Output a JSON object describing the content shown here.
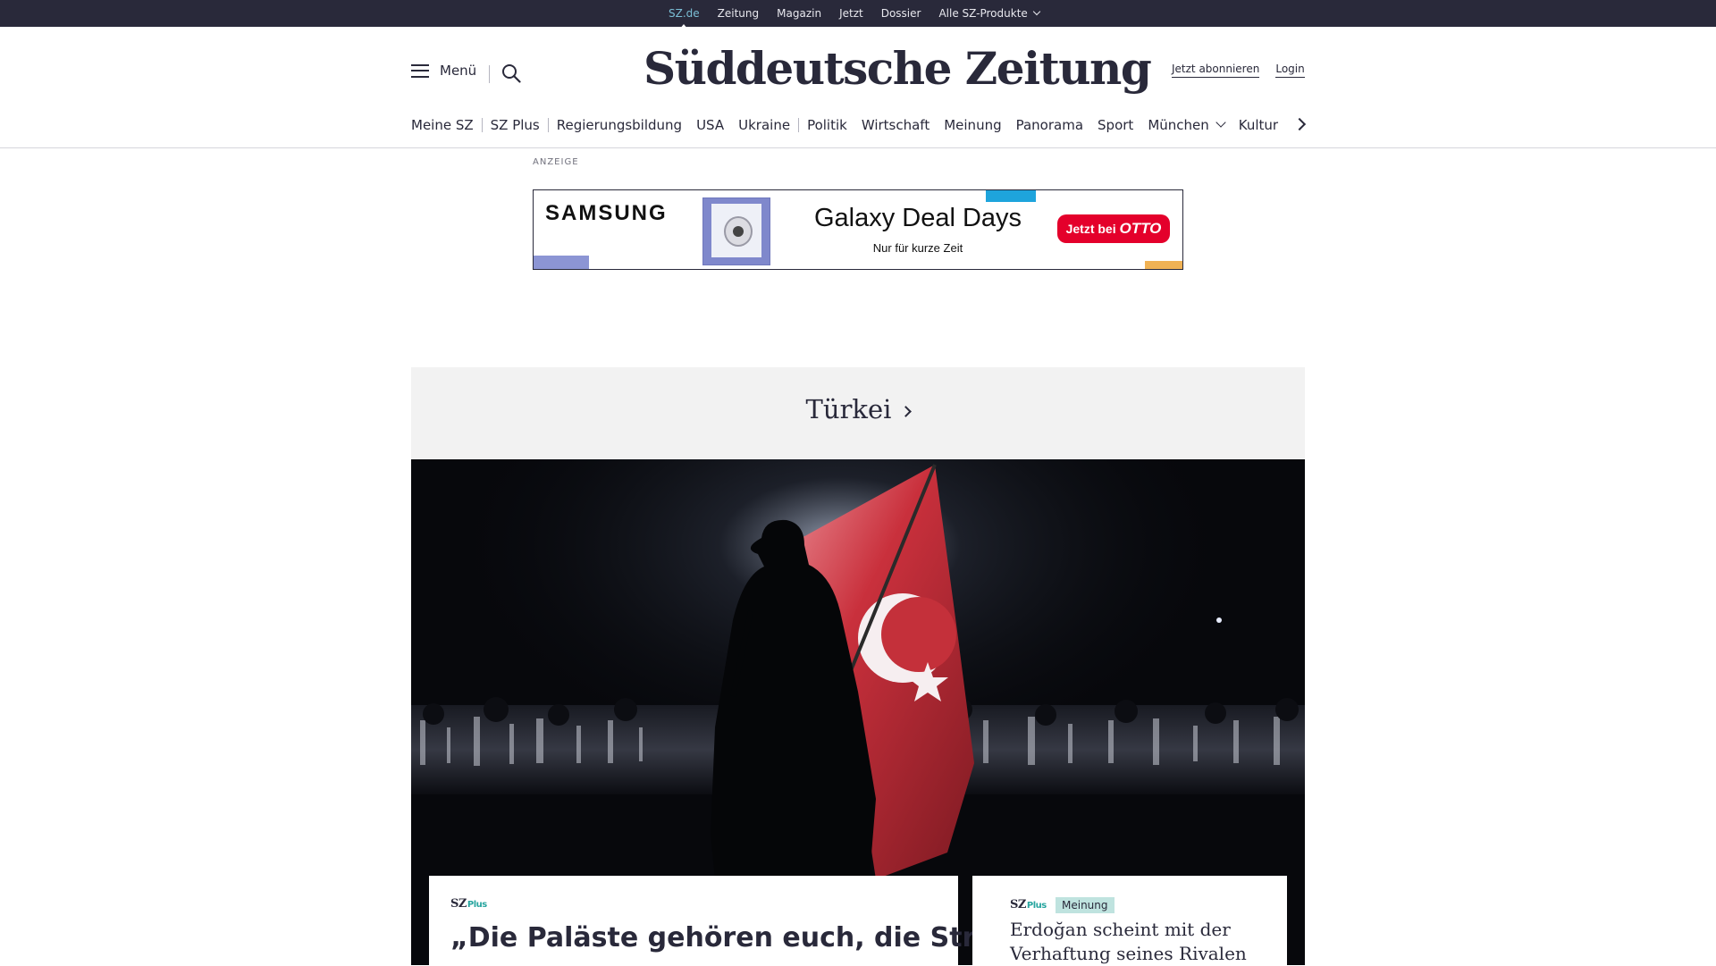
{
  "topbar": {
    "items": [
      "SZ.de",
      "Zeitung",
      "Magazin",
      "Jetzt",
      "Dossier"
    ],
    "dropdown_label": "Alle SZ-Produkte"
  },
  "header": {
    "menu_label": "Menü",
    "logo_text": "Süddeutsche Zeitung",
    "subscribe_label": "Jetzt abonnieren",
    "login_label": "Login"
  },
  "nav": {
    "items": [
      "Meine SZ",
      "SZ Plus",
      "Regierungsbildung",
      "USA",
      "Ukraine",
      "Politik",
      "Wirtschaft",
      "Meinung",
      "Panorama",
      "Sport",
      "München",
      "Kultur"
    ]
  },
  "ad": {
    "label": "ANZEIGE",
    "brand": "SAMSUNG",
    "title": "Galaxy Deal Days",
    "subtitle": "Nur für kurze Zeit",
    "cta_prefix": "Jetzt bei",
    "cta_brand": "OTTO"
  },
  "topic": {
    "title": "Türkei"
  },
  "articles": {
    "main": {
      "brand": "SZ",
      "plus": "Plus",
      "headline": "„Die Paläste gehören euch, die Straßen"
    },
    "side": {
      "brand": "SZ",
      "plus": "Plus",
      "badge": "Meinung",
      "headline": "Erdoğan scheint mit der Verhaftung seines Rivalen"
    }
  },
  "colors": {
    "dark": "#29293a",
    "active_link": "#7bbfd6",
    "plus_accent": "#27a59f",
    "badge_bg": "#bfe3df",
    "flag_red": "#c9303c",
    "otto_red": "#e4002b"
  }
}
